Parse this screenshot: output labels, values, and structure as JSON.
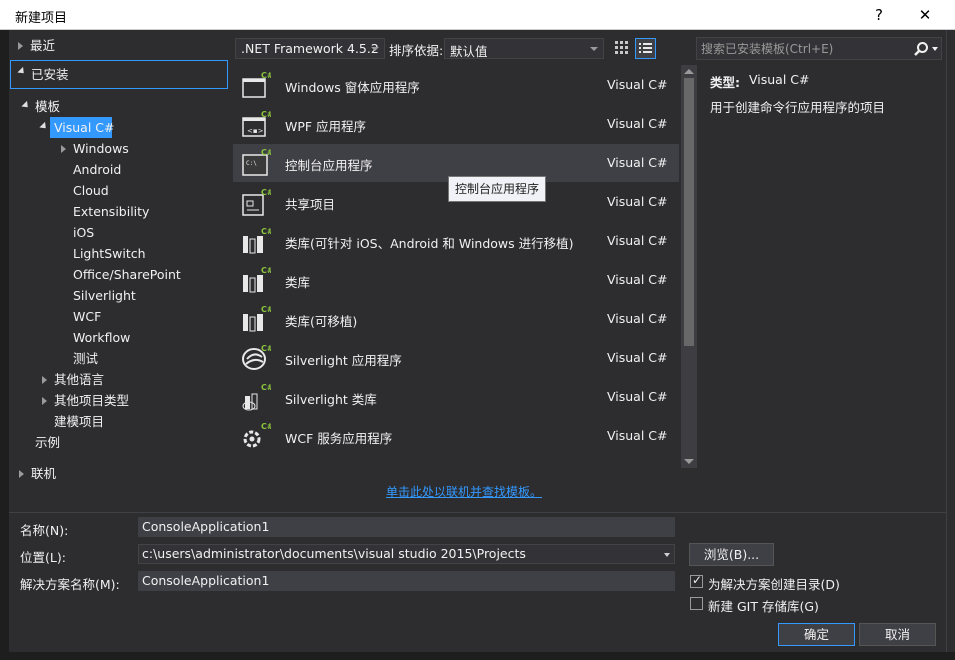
{
  "window": {
    "title": "新建项目",
    "help_glyph": "?",
    "close_glyph": "✕"
  },
  "nav": {
    "recent": "最近",
    "installed": "已安装",
    "templates": "模板",
    "visual_csharp": "Visual C#",
    "children": [
      "Windows",
      "Android",
      "Cloud",
      "Extensibility",
      "iOS",
      "LightSwitch",
      "Office/SharePoint",
      "Silverlight",
      "WCF",
      "Workflow",
      "测试"
    ],
    "other_languages": "其他语言",
    "other_project_types": "其他项目类型",
    "modeling_projects": "建模项目",
    "samples": "示例",
    "online": "联机"
  },
  "toolbar": {
    "framework": ".NET Framework 4.5.2",
    "sort_label": "排序依据:",
    "sort_value": "默认值",
    "search_placeholder": "搜索已安装模板(Ctrl+E)"
  },
  "templates": [
    {
      "name": "Windows 窗体应用程序",
      "lang": "Visual C#",
      "icon": "windows-forms-icon"
    },
    {
      "name": "WPF 应用程序",
      "lang": "Visual C#",
      "icon": "wpf-icon"
    },
    {
      "name": "控制台应用程序",
      "lang": "Visual C#",
      "icon": "console-icon"
    },
    {
      "name": "共享项目",
      "lang": "Visual C#",
      "icon": "shared-project-icon"
    },
    {
      "name": "类库(可针对 iOS、Android 和 Windows 进行移植)",
      "lang": "Visual C#",
      "icon": "portable-library-icon"
    },
    {
      "name": "类库",
      "lang": "Visual C#",
      "icon": "class-library-icon"
    },
    {
      "name": "类库(可移植)",
      "lang": "Visual C#",
      "icon": "portable-class-library-icon"
    },
    {
      "name": "Silverlight 应用程序",
      "lang": "Visual C#",
      "icon": "silverlight-app-icon"
    },
    {
      "name": "Silverlight 类库",
      "lang": "Visual C#",
      "icon": "silverlight-library-icon"
    },
    {
      "name": "WCF 服务应用程序",
      "lang": "Visual C#",
      "icon": "wcf-service-icon"
    }
  ],
  "tooltip": "控制台应用程序",
  "online_link": "单击此处以联机并查找模板。",
  "info": {
    "type_label": "类型:",
    "type_value": "Visual C#",
    "description": "用于创建命令行应用程序的项目"
  },
  "form": {
    "name_label": "名称(N):",
    "name_value": "ConsoleApplication1",
    "location_label": "位置(L):",
    "location_value": "c:\\users\\administrator\\documents\\visual studio 2015\\Projects",
    "solution_label": "解决方案名称(M):",
    "solution_value": "ConsoleApplication1",
    "browse": "浏览(B)...",
    "create_dir": "为解决方案创建目录(D)",
    "create_dir_checked": true,
    "git": "新建 GIT 存储库(G)",
    "git_checked": false,
    "ok": "确定",
    "cancel": "取消"
  },
  "colors": {
    "accent": "#3399ff",
    "background": "#2d2d30",
    "selected_row": "#3f3f46"
  }
}
